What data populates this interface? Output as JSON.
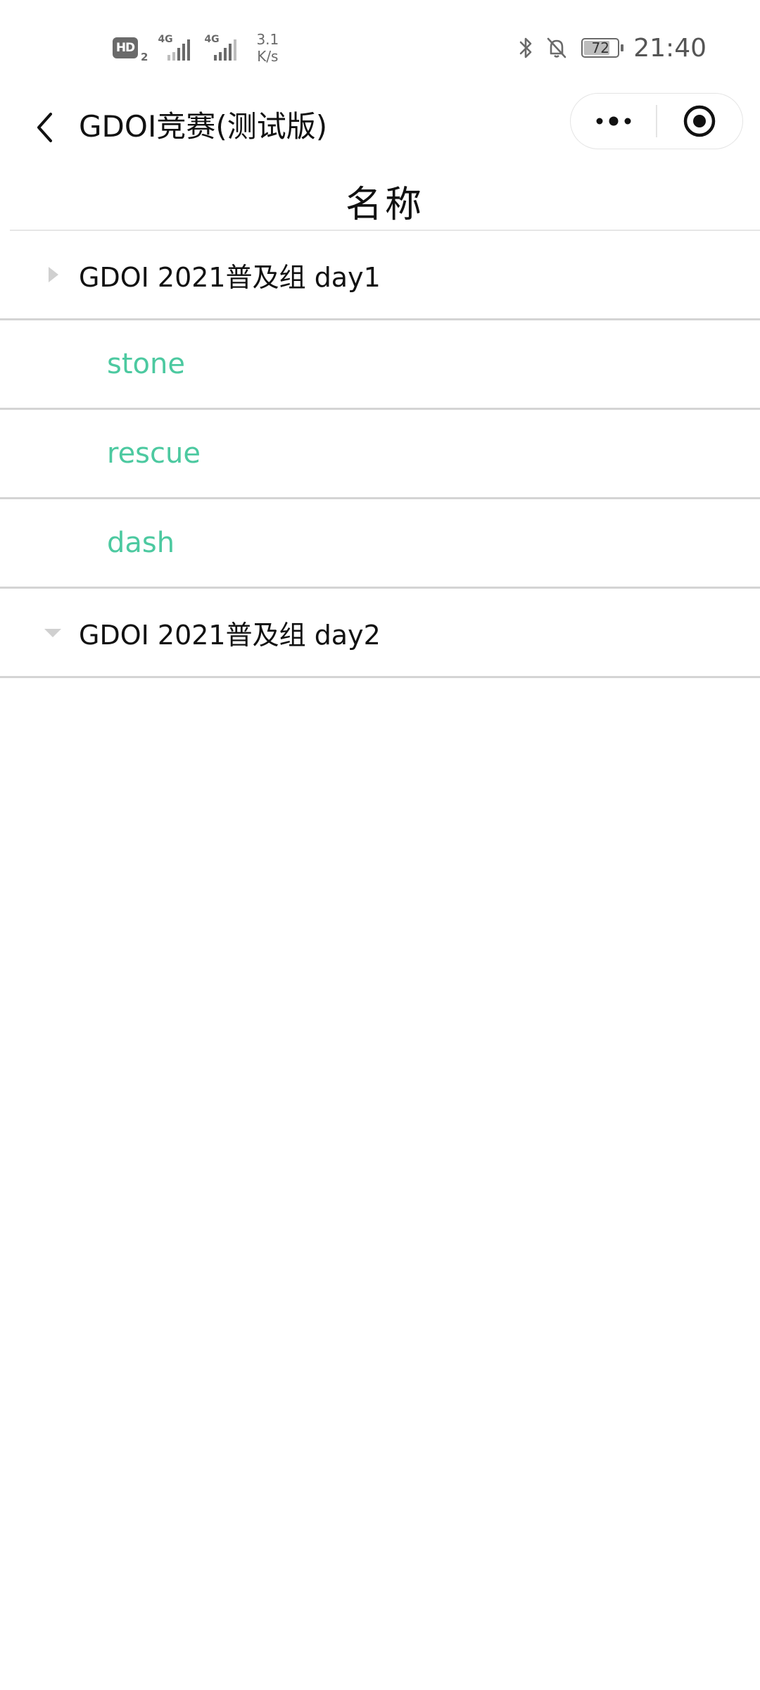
{
  "status_bar": {
    "hd_label": "HD",
    "hd_sub": "2",
    "signal1_gen": "4G",
    "signal2_gen": "4G",
    "net_speed_value": "3.1",
    "net_speed_unit": "K/s",
    "battery": "72",
    "time": "21:40",
    "icons": [
      "hd-icon",
      "signal-icon",
      "signal-icon",
      "bluetooth-icon",
      "bell-off-icon",
      "battery-icon"
    ]
  },
  "nav": {
    "back_icon": "chevron-left-icon",
    "title": "GDOI竞赛(测试版)",
    "more_icon": "more-dots-icon",
    "close_icon": "target-circle-icon"
  },
  "header": {
    "title": "名称"
  },
  "tree": [
    {
      "label": "GDOI 2021普及组 day1",
      "arrow": "triangle-right-icon",
      "children": [
        "stone",
        "rescue",
        "dash"
      ]
    },
    {
      "label": "GDOI 2021普及组 day2",
      "arrow": "triangle-down-icon",
      "children": []
    }
  ],
  "colors": {
    "child_text": "#4cc9a0",
    "divider": "#d4d4d4",
    "status_icons": "#6a6a6a"
  }
}
